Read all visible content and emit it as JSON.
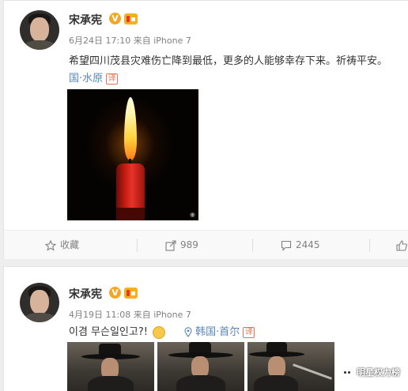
{
  "posts": [
    {
      "username": "宋承宪",
      "verified_icon": "verified-v-icon",
      "badge_icon": "member-badge-icon",
      "timestamp": "6月24日 17:10",
      "source_prefix": "来自",
      "source": "iPhone 7",
      "text": "希望四川茂县灾难伤亡降到最低，更多的人能够幸存下来。祈祷平安。",
      "location_label": "国·水原",
      "translate_label": "译",
      "image_watermark": "◉",
      "actions": {
        "favorite_label": "收藏",
        "repost_count": "989",
        "comment_count": "2445"
      }
    },
    {
      "username": "宋承宪",
      "verified_icon": "verified-v-icon",
      "badge_icon": "member-badge-icon",
      "timestamp": "4月19日 11:08",
      "source_prefix": "来自",
      "source": "iPhone 7",
      "text": "이겸 무슨일인고?!",
      "emoji_icon": "thinking-emoji-icon",
      "location_label": "韩国·首尔",
      "translate_label": "译"
    }
  ],
  "wechat_watermark": "明星权力榜",
  "colors": {
    "link_orange": "#eb7350",
    "link_blue": "#5885b8",
    "verified_gold": "#f5a623"
  }
}
